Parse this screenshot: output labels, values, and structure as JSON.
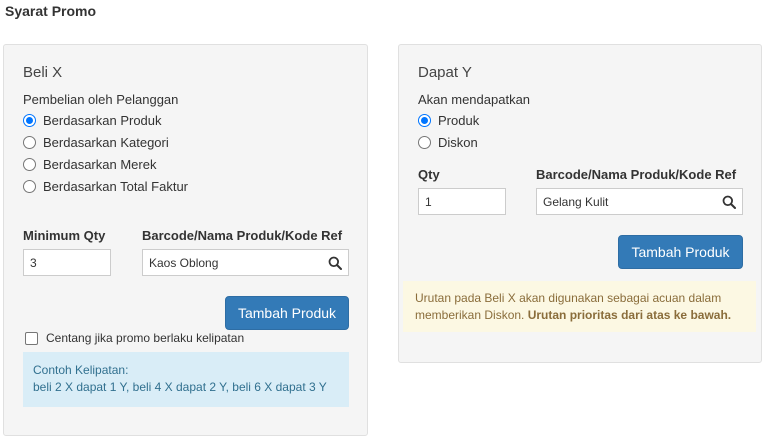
{
  "page": {
    "title": "Syarat Promo"
  },
  "buy": {
    "heading": "Beli X",
    "subtitle": "Pembelian oleh Pelanggan",
    "options": [
      {
        "label": "Berdasarkan Produk",
        "checked": true
      },
      {
        "label": "Berdasarkan Kategori",
        "checked": false
      },
      {
        "label": "Berdasarkan Merek",
        "checked": false
      },
      {
        "label": "Berdasarkan Total Faktur",
        "checked": false
      }
    ],
    "min_qty_label": "Minimum Qty",
    "min_qty_value": "3",
    "product_label": "Barcode/Nama Produk/Kode Ref",
    "product_value": "Kaos Oblong",
    "add_button": "Tambah Produk",
    "multiple_checkbox_label": "Centang jika promo berlaku kelipatan",
    "example_title": "Contoh Kelipatan:",
    "example_text": "beli 2 X dapat 1 Y, beli 4 X dapat 2 Y, beli 6 X dapat 3 Y"
  },
  "get": {
    "heading": "Dapat Y",
    "subtitle": "Akan mendapatkan",
    "options": [
      {
        "label": "Produk",
        "checked": true
      },
      {
        "label": "Diskon",
        "checked": false
      }
    ],
    "qty_label": "Qty",
    "qty_value": "1",
    "product_label": "Barcode/Nama Produk/Kode Ref",
    "product_value": "Gelang Kulit",
    "add_button": "Tambah Produk",
    "note_text": "Urutan pada Beli X akan digunakan sebagai acuan dalam memberikan Diskon.",
    "note_bold": "Urutan prioritas dari atas ke bawah."
  },
  "icons": {
    "search": "search-icon"
  },
  "colors": {
    "primary": "#337ab7",
    "info_bg": "#d9edf7",
    "warning_bg": "#fcf8e3",
    "radio_checked": "#0075ff"
  }
}
